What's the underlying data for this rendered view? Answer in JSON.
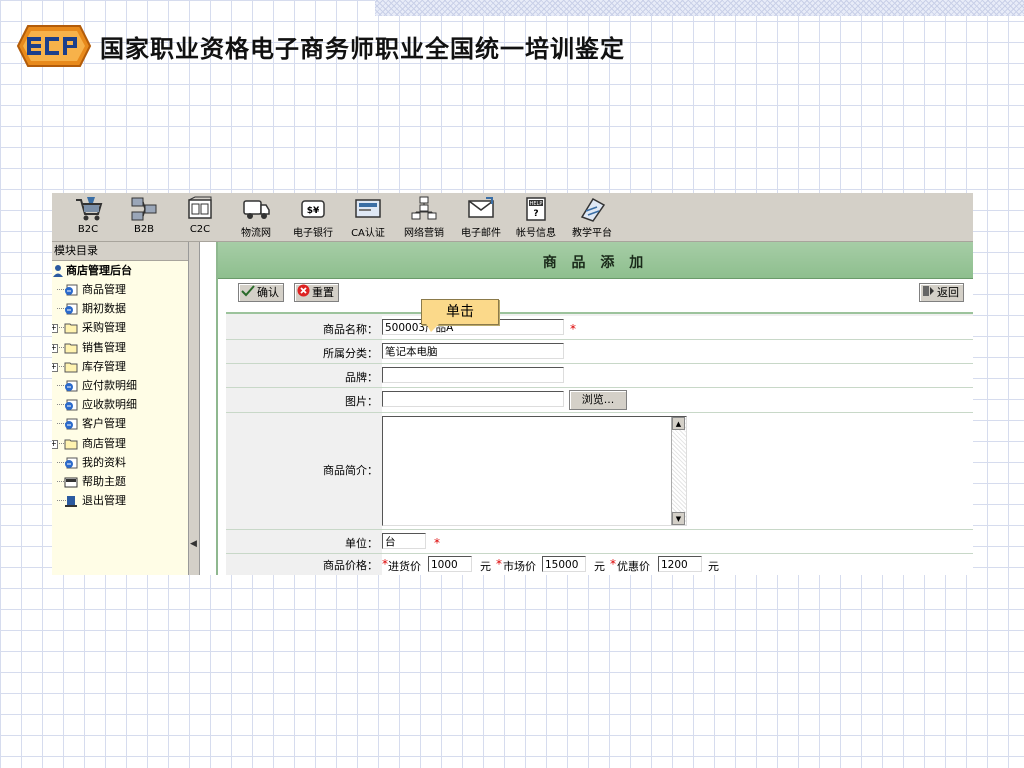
{
  "slide": {
    "title": "国家职业资格电子商务师职业全国统一培训鉴定"
  },
  "logo": {
    "text": "ECP"
  },
  "toolbar": {
    "items": [
      {
        "label": "B2C",
        "icon": "shopping-cart-icon"
      },
      {
        "label": "B2B",
        "icon": "network-nodes-icon"
      },
      {
        "label": "C2C",
        "icon": "exchange-icon"
      },
      {
        "label": "物流网",
        "icon": "truck-icon"
      },
      {
        "label": "电子银行",
        "icon": "bank-card-icon"
      },
      {
        "label": "CA认证",
        "icon": "certificate-icon"
      },
      {
        "label": "网络营销",
        "icon": "marketing-icon"
      },
      {
        "label": "电子邮件",
        "icon": "mail-icon"
      },
      {
        "label": "帐号信息",
        "icon": "help-book-icon"
      },
      {
        "label": "教学平台",
        "icon": "teaching-icon"
      }
    ]
  },
  "sidebar": {
    "header": "模块目录",
    "root": "商店管理后台",
    "items": [
      {
        "label": "商品管理",
        "type": "page"
      },
      {
        "label": "期初数据",
        "type": "page"
      },
      {
        "label": "采购管理",
        "type": "folder"
      },
      {
        "label": "销售管理",
        "type": "folder"
      },
      {
        "label": "库存管理",
        "type": "folder"
      },
      {
        "label": "应付款明细",
        "type": "page"
      },
      {
        "label": "应收款明细",
        "type": "page"
      },
      {
        "label": "客户管理",
        "type": "page"
      },
      {
        "label": "商店管理",
        "type": "folder"
      },
      {
        "label": "我的资料",
        "type": "page"
      },
      {
        "label": "帮助主题",
        "type": "help"
      },
      {
        "label": "退出管理",
        "type": "exit"
      }
    ]
  },
  "main": {
    "title": "商 品 添 加",
    "confirm": "确认",
    "reset": "重置",
    "back": "返回",
    "callout": "单击"
  },
  "form": {
    "name_label": "商品名称：",
    "name_value": "500003产品A",
    "category_label": "所属分类：",
    "category_value": "笔记本电脑",
    "brand_label": "品牌：",
    "brand_value": "",
    "image_label": "图片：",
    "image_value": "",
    "browse": "浏览...",
    "desc_label": "商品简介：",
    "unit_label": "单位：",
    "unit_value": "台",
    "price_label": "商品价格：",
    "purchase_label": "进货价",
    "purchase_value": "1000",
    "market_label": "市场价",
    "market_value": "15000",
    "discount_label": "优惠价",
    "discount_value": "1200",
    "currency": "元",
    "required_mark": "*"
  },
  "colors": {
    "title_bar": "#9ec89e",
    "callout": "#fbd98a",
    "required": "#dd0000",
    "toolbar": "#d4d0c8",
    "sidebar": "#fffde6"
  }
}
